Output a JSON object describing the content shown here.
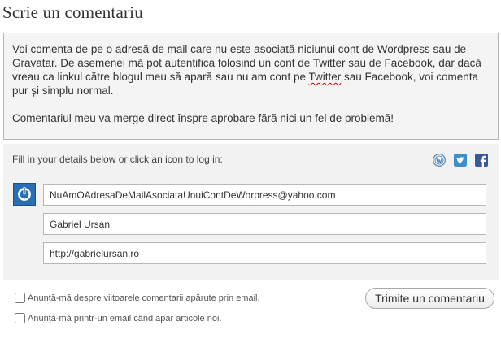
{
  "title": "Scrie un comentariu",
  "comment": {
    "para1_before": "Voi comenta de pe o adresă de mail care nu este asociată niciunui cont de Wordpress sau de Gravatar. De asemenei mă pot autentifica folosind un cont de Twitter sau de Facebook, dar dacă vreau ca linkul către blogul meu să apară sau nu am cont pe ",
    "para1_misspelled": "Twitter",
    "para1_after": " sau Facebook, voi comenta pur și simplu normal.",
    "para2": "Comentariul meu va merge direct înspre aprobare fără nici un fel de problemă!"
  },
  "details": {
    "hint": "Fill in your details below or click an icon to log in:",
    "icons": [
      "wordpress-icon",
      "twitter-icon",
      "facebook-icon"
    ],
    "email_value": "NuAmOAdresaDeMailAsociataUnuiContDeWorpress@yahoo.com",
    "name_value": "Gabriel Ursan",
    "website_value": "http://gabrielursan.ro"
  },
  "options": {
    "notify_comments": "Anunță-mă despre viitoarele comentarii apărute prin email.",
    "notify_posts": "Anunță-mă printr-un email când apar articole noi."
  },
  "submit_label": "Trimite un comentariu",
  "colors": {
    "wordpress": "#5a8fb8",
    "twitter": "#3d8fc8",
    "facebook": "#3b5998",
    "avatar": "#2a6fb3"
  }
}
